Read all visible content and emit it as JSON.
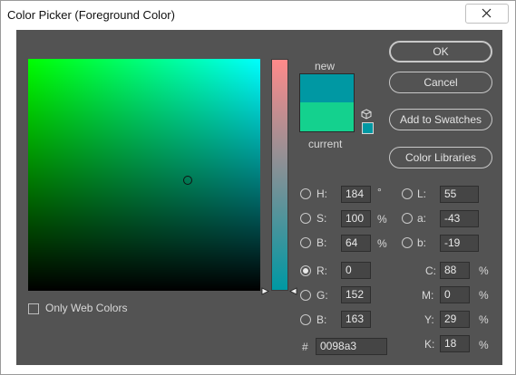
{
  "window": {
    "title": "Color Picker (Foreground Color)"
  },
  "preview": {
    "new_label": "new",
    "current_label": "current",
    "new_color": "#0098a3",
    "current_color": "#14d18e"
  },
  "buttons": {
    "ok": "OK",
    "cancel": "Cancel",
    "add_to_swatches": "Add to Swatches",
    "color_libraries": "Color Libraries"
  },
  "only_web_colors": {
    "label": "Only Web Colors",
    "checked": false
  },
  "hsb": {
    "h": {
      "label": "H:",
      "value": "184",
      "unit": "°"
    },
    "s": {
      "label": "S:",
      "value": "100",
      "unit": "%"
    },
    "b": {
      "label": "B:",
      "value": "64",
      "unit": "%"
    }
  },
  "rgb": {
    "selected": "R",
    "r": {
      "label": "R:",
      "value": "0"
    },
    "g": {
      "label": "G:",
      "value": "152"
    },
    "b": {
      "label": "B:",
      "value": "163"
    }
  },
  "lab": {
    "l": {
      "label": "L:",
      "value": "55"
    },
    "a": {
      "label": "a:",
      "value": "-43"
    },
    "b": {
      "label": "b:",
      "value": "-19"
    }
  },
  "cmyk": {
    "c": {
      "label": "C:",
      "value": "88",
      "unit": "%"
    },
    "m": {
      "label": "M:",
      "value": "0",
      "unit": "%"
    },
    "y": {
      "label": "Y:",
      "value": "29",
      "unit": "%"
    },
    "k": {
      "label": "K:",
      "value": "18",
      "unit": "%"
    }
  },
  "hex": {
    "label": "#",
    "value": "0098a3"
  },
  "icons": {
    "close": "close-icon",
    "websafe": "cube-icon"
  }
}
